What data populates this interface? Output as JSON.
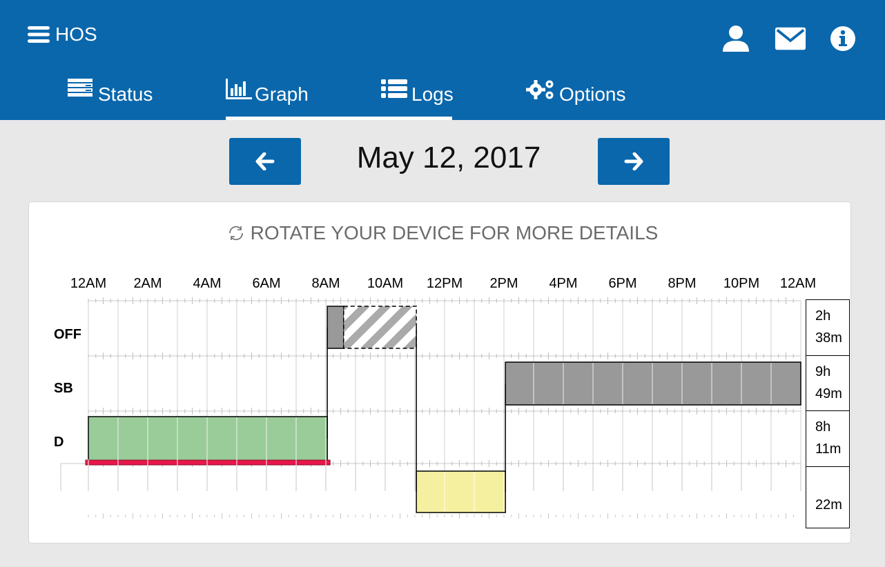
{
  "header": {
    "app_title": "HOS",
    "menu_icon": "hamburger-icon",
    "actions": [
      {
        "name": "profile",
        "icon": "user-icon"
      },
      {
        "name": "messages",
        "icon": "envelope-icon"
      },
      {
        "name": "info",
        "icon": "info-circle-icon"
      }
    ],
    "tabs": [
      {
        "label": "Status",
        "icon": "status-bars-icon",
        "active": false
      },
      {
        "label": "Graph",
        "icon": "bar-chart-icon",
        "active": true
      },
      {
        "label": "Logs",
        "icon": "list-icon",
        "active": false
      },
      {
        "label": "Options",
        "icon": "gears-icon",
        "active": false
      }
    ],
    "colors": {
      "brand": "#0a67ac",
      "text": "#ffffff"
    }
  },
  "date_nav": {
    "date": "May 12, 2017",
    "prev_icon": "arrow-left-icon",
    "next_icon": "arrow-right-icon"
  },
  "graph_card": {
    "rotate_message": "ROTATE YOUR DEVICE FOR MORE DETAILS",
    "rotate_icon": "rotate-icon",
    "hour_labels": [
      "12AM",
      "2AM",
      "4AM",
      "6AM",
      "8AM",
      "10AM",
      "12PM",
      "2PM",
      "4PM",
      "6PM",
      "8PM",
      "10PM",
      "12AM"
    ],
    "rows": [
      {
        "label": "OFF",
        "total_h": "2h",
        "total_m": "38m"
      },
      {
        "label": "SB",
        "total_h": "9h",
        "total_m": "49m"
      },
      {
        "label": "D",
        "total_h": "8h",
        "total_m": "11m"
      },
      {
        "label": "",
        "total_h": "",
        "total_m": "22m"
      }
    ],
    "segments": [
      {
        "status": "D",
        "start_h": 0.0,
        "end_h": 8.05,
        "color": "#99cc99"
      },
      {
        "status": "OFF",
        "start_h": 8.05,
        "end_h": 8.6,
        "color": "#999999"
      },
      {
        "status": "OFF",
        "start_h": 8.6,
        "end_h": 11.05,
        "color": "#999999",
        "pattern": "hatched",
        "edit_pending": true
      },
      {
        "status": "ON",
        "start_h": 11.05,
        "end_h": 14.05,
        "color": "#f5f0a0"
      },
      {
        "status": "SB",
        "start_h": 14.05,
        "end_h": 24.0,
        "color": "#999999"
      }
    ],
    "violation": {
      "start_h": 0.0,
      "end_h": 8.05,
      "color": "#e8174a"
    }
  }
}
